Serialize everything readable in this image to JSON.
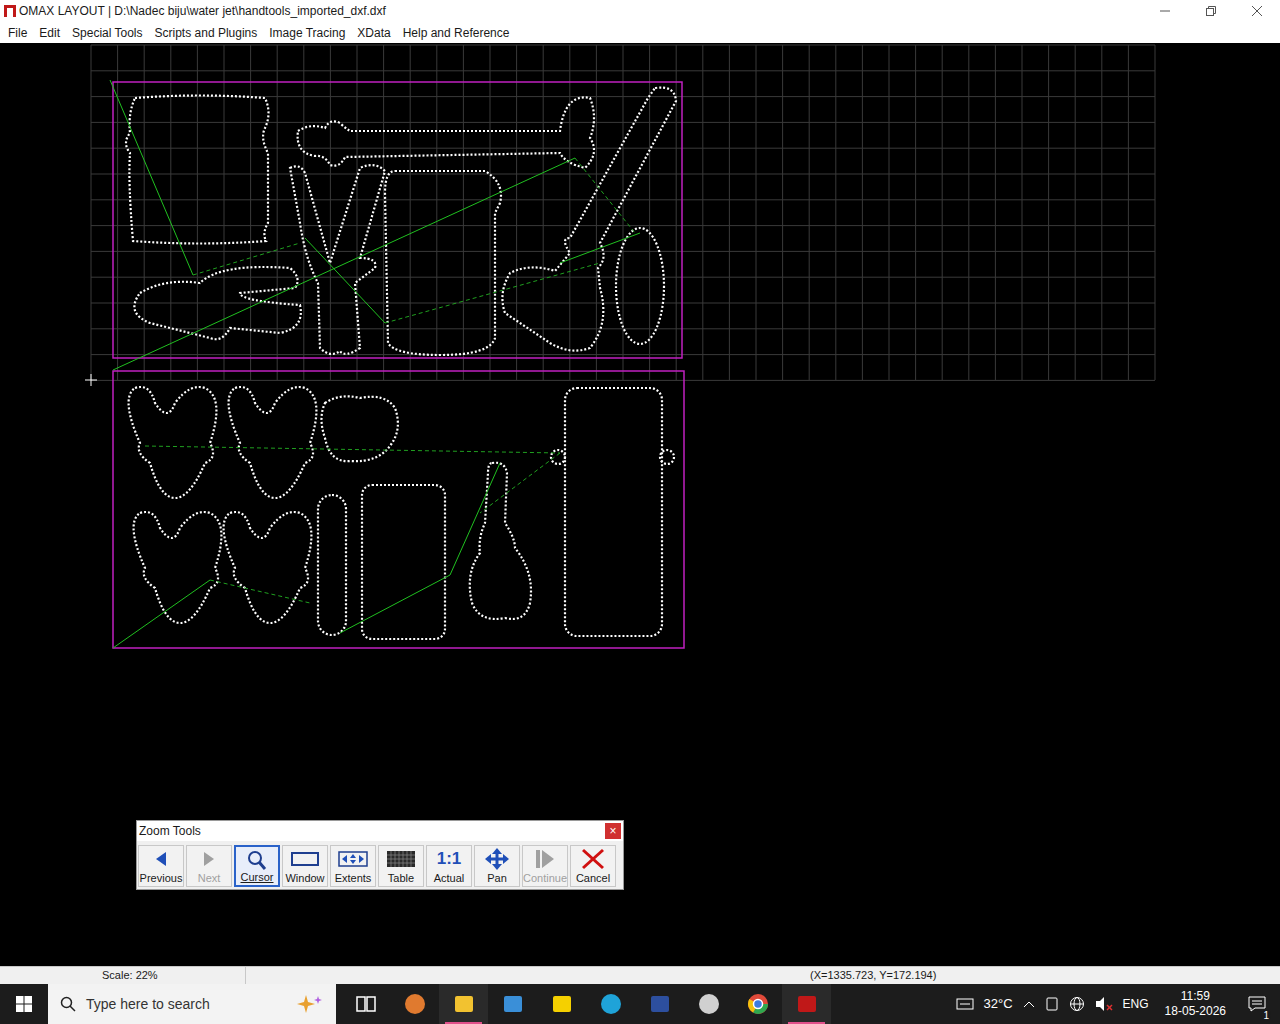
{
  "window": {
    "title": "OMAX LAYOUT | D:\\Nadec biju\\water jet\\handtools_imported_dxf.dxf"
  },
  "menu": [
    "File",
    "Edit",
    "Special Tools",
    "Scripts and Plugins",
    "Image Tracing",
    "XData",
    "Help and Reference"
  ],
  "zoom_tools": {
    "title": "Zoom Tools",
    "close": "×",
    "buttons": [
      {
        "label": "Previous",
        "kind": "previous",
        "disabled": false,
        "selected": false
      },
      {
        "label": "Next",
        "kind": "next",
        "disabled": true,
        "selected": false
      },
      {
        "label": "Cursor",
        "kind": "cursor",
        "disabled": false,
        "selected": true
      },
      {
        "label": "Window",
        "kind": "window",
        "disabled": false,
        "selected": false
      },
      {
        "label": "Extents",
        "kind": "extents",
        "disabled": false,
        "selected": false
      },
      {
        "label": "Table",
        "kind": "table",
        "disabled": false,
        "selected": false
      },
      {
        "label": "Actual",
        "kind": "actual",
        "icon_text": "1:1",
        "disabled": false,
        "selected": false
      },
      {
        "label": "Pan",
        "kind": "pan",
        "disabled": false,
        "selected": false
      },
      {
        "label": "Continue",
        "kind": "continue",
        "disabled": true,
        "selected": false
      },
      {
        "label": "Cancel",
        "kind": "cancel",
        "disabled": false,
        "selected": false
      }
    ]
  },
  "status_bar": {
    "scale": "Scale: 22%",
    "coords": "(X=1335.723, Y=172.194)"
  },
  "taskbar": {
    "search_placeholder": "Type here to search",
    "weather": "32°C",
    "language": "ENG",
    "time": "11:59",
    "date": "18-05-2026",
    "notifications": "1",
    "apps": [
      {
        "name": "task-view",
        "active": false,
        "color": "#ffffff"
      },
      {
        "name": "copilot",
        "active": false,
        "color": "#e07a2f"
      },
      {
        "name": "file-explorer",
        "active": true,
        "color": "#f2c230"
      },
      {
        "name": "calculator",
        "active": false,
        "color": "#3a8fd8"
      },
      {
        "name": "sticky-notes",
        "active": false,
        "color": "#f5d000"
      },
      {
        "name": "edge",
        "active": false,
        "color": "#1fa3d8"
      },
      {
        "name": "app-window",
        "active": false,
        "color": "#2d4f9e"
      },
      {
        "name": "settings-app",
        "active": false,
        "color": "#d0d0d0"
      },
      {
        "name": "chrome",
        "active": false,
        "color": "#e04a3a"
      },
      {
        "name": "omax-layout",
        "active": true,
        "color": "#c01818"
      }
    ]
  }
}
